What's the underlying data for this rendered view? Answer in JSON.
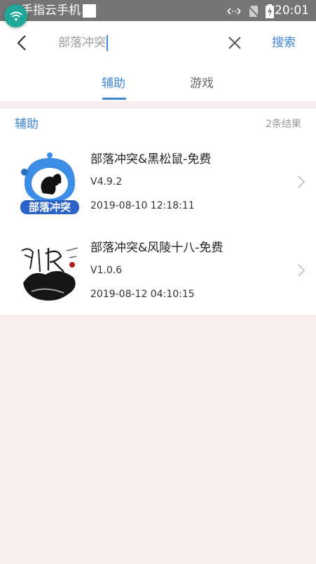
{
  "status_bar": {
    "carrier": "手指云手机",
    "time": "20:01",
    "icons": [
      "wifi-icon",
      "data-arrows-icon",
      "no-sim-icon",
      "battery-charging-icon"
    ]
  },
  "search": {
    "query": "部落冲突",
    "search_label": "搜索"
  },
  "tabs": [
    {
      "label": "辅助",
      "active": true
    },
    {
      "label": "游戏",
      "active": false
    }
  ],
  "section": {
    "title": "辅助",
    "count": "2条结果"
  },
  "results": [
    {
      "name": "部落冲突&黑松鼠-免费",
      "version": "V4.9.2",
      "date": "2019-08-10 12:18:11",
      "icon": "clash-squirrel-icon",
      "icon_text": "部落冲突"
    },
    {
      "name": "部落冲突&风陵十八-免费",
      "version": "V1.0.6",
      "date": "2019-08-12 04:10:15",
      "icon": "fengling-ink-icon",
      "icon_text": "风陵"
    }
  ],
  "colors": {
    "accent": "#3f86d6",
    "statusbar": "#757575",
    "background": "#f6eded",
    "bubble": "#1fa79a"
  }
}
